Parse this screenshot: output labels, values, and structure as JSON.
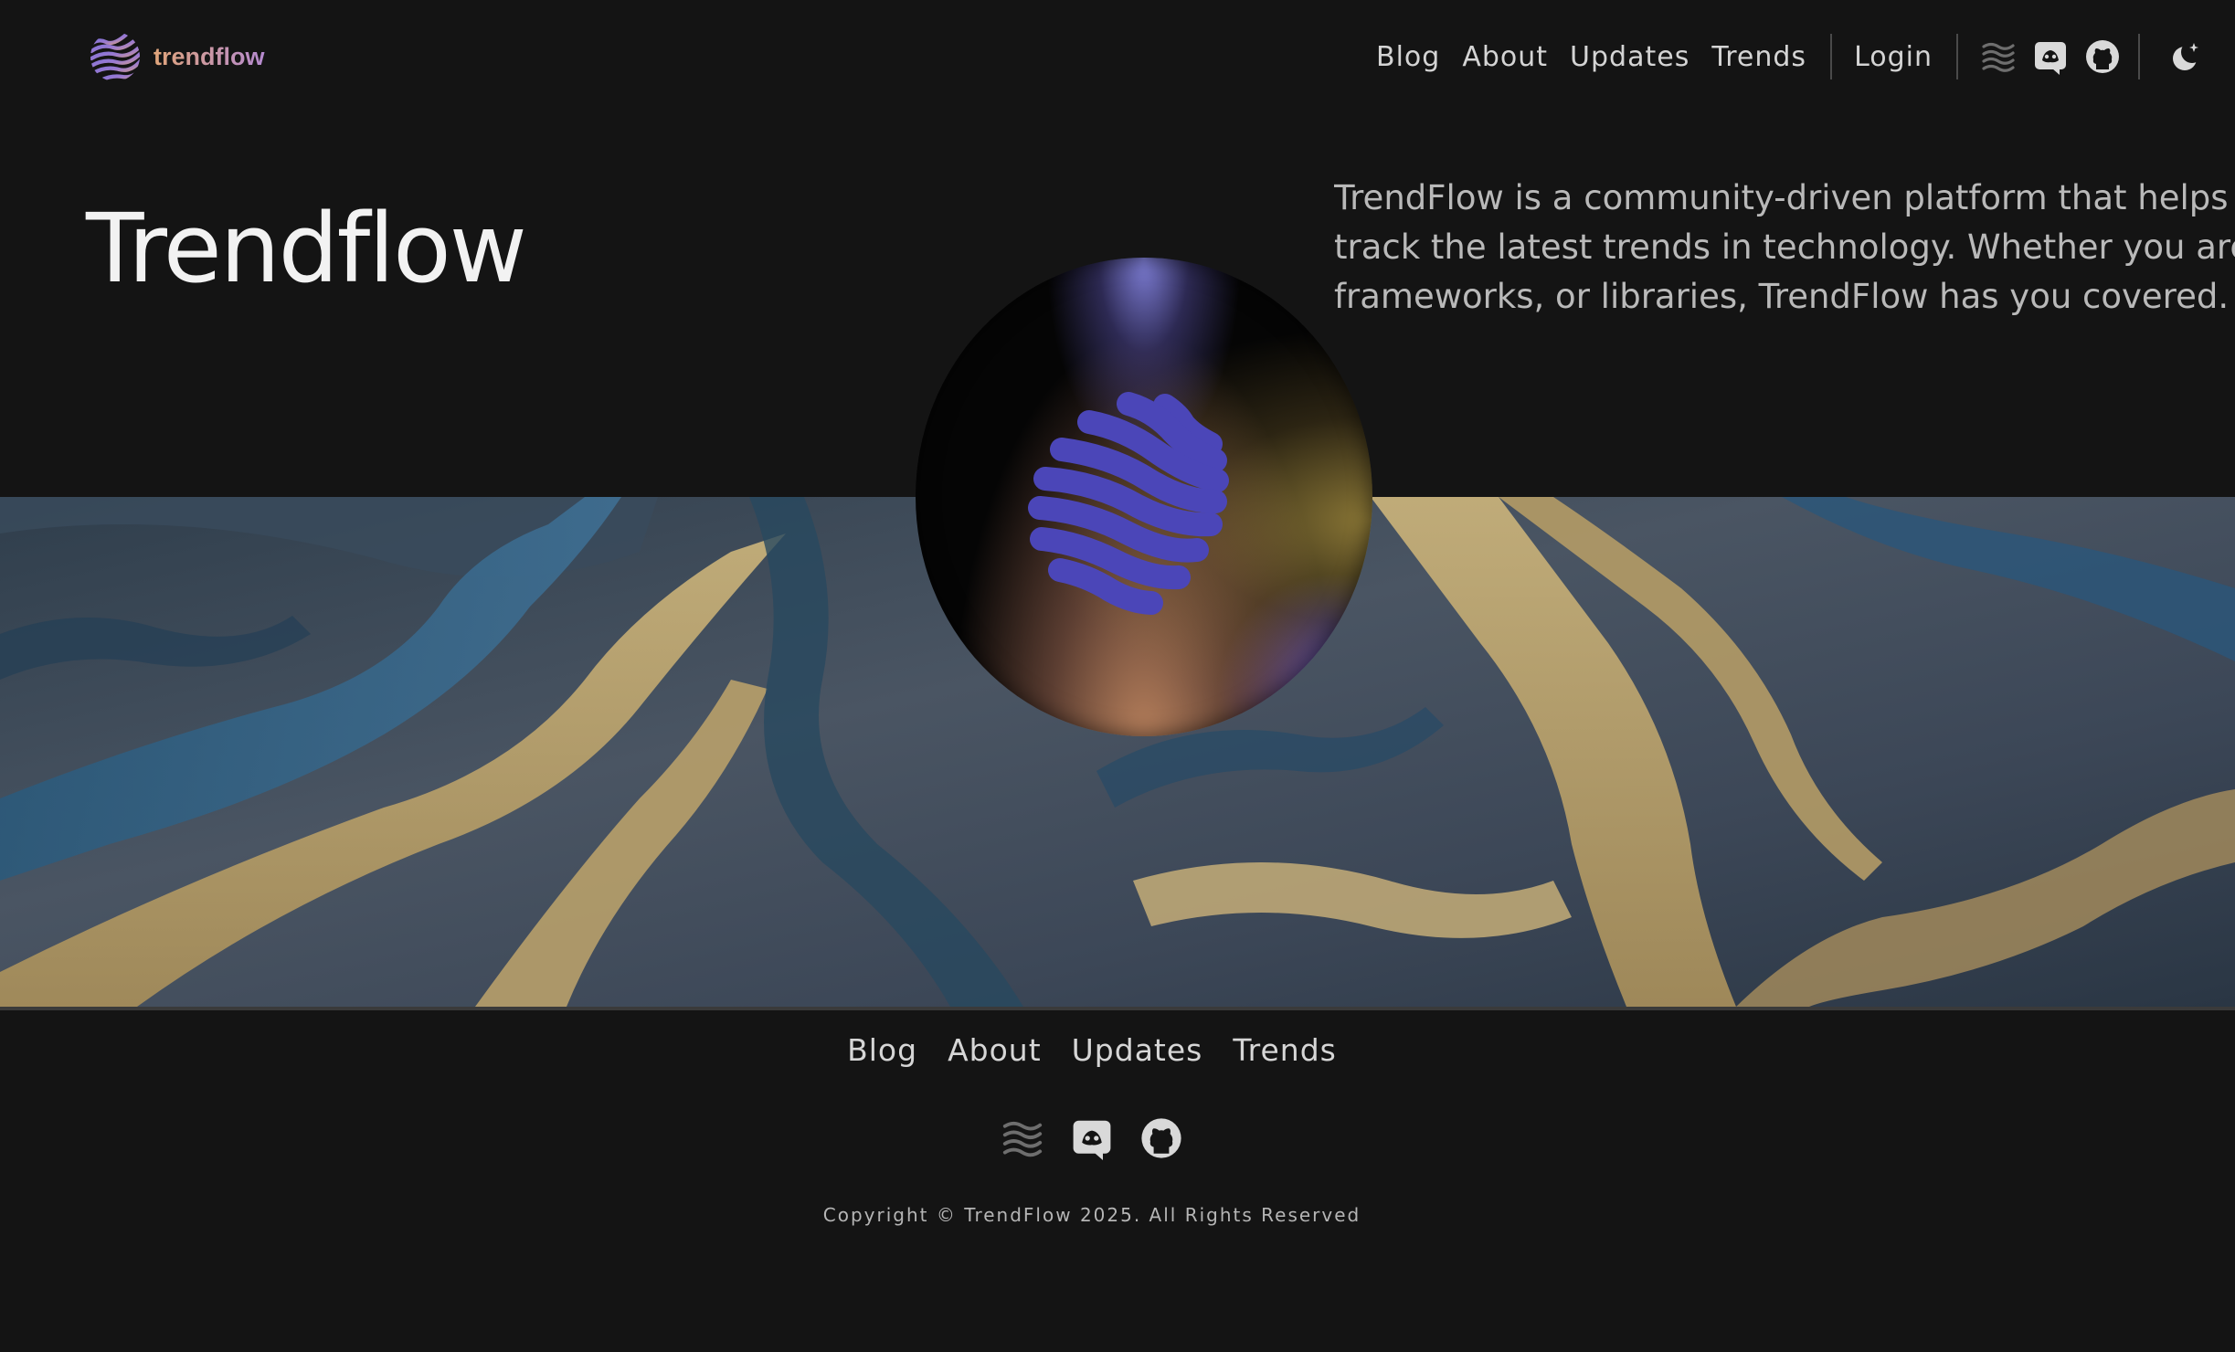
{
  "brand": {
    "name": "trendflow",
    "logo_icon": "trendflow-wave-logo"
  },
  "header": {
    "nav": [
      "Blog",
      "About",
      "Updates",
      "Trends"
    ],
    "login_label": "Login",
    "icons": [
      "waves-icon",
      "discord-icon",
      "github-icon",
      "moon-icon"
    ]
  },
  "hero": {
    "title": "Trendflow",
    "description_lines": [
      "TrendFlow is a community-driven platform that helps de",
      "track the latest trends in technology. Whether you are lo",
      "frameworks, or libraries, TrendFlow has you covered."
    ],
    "image": "aerial braided river landscape"
  },
  "footer": {
    "nav": [
      "Blog",
      "About",
      "Updates",
      "Trends"
    ],
    "icons": [
      "waves-icon",
      "discord-icon",
      "github-icon"
    ],
    "copyright": "Copyright © TrendFlow  2025. All Rights Reserved"
  },
  "colors": {
    "background": "#141414",
    "brand_gradient_start": "#e0a57a",
    "brand_gradient_end": "#b58ad0",
    "orb_logo": "#4b46b8"
  }
}
